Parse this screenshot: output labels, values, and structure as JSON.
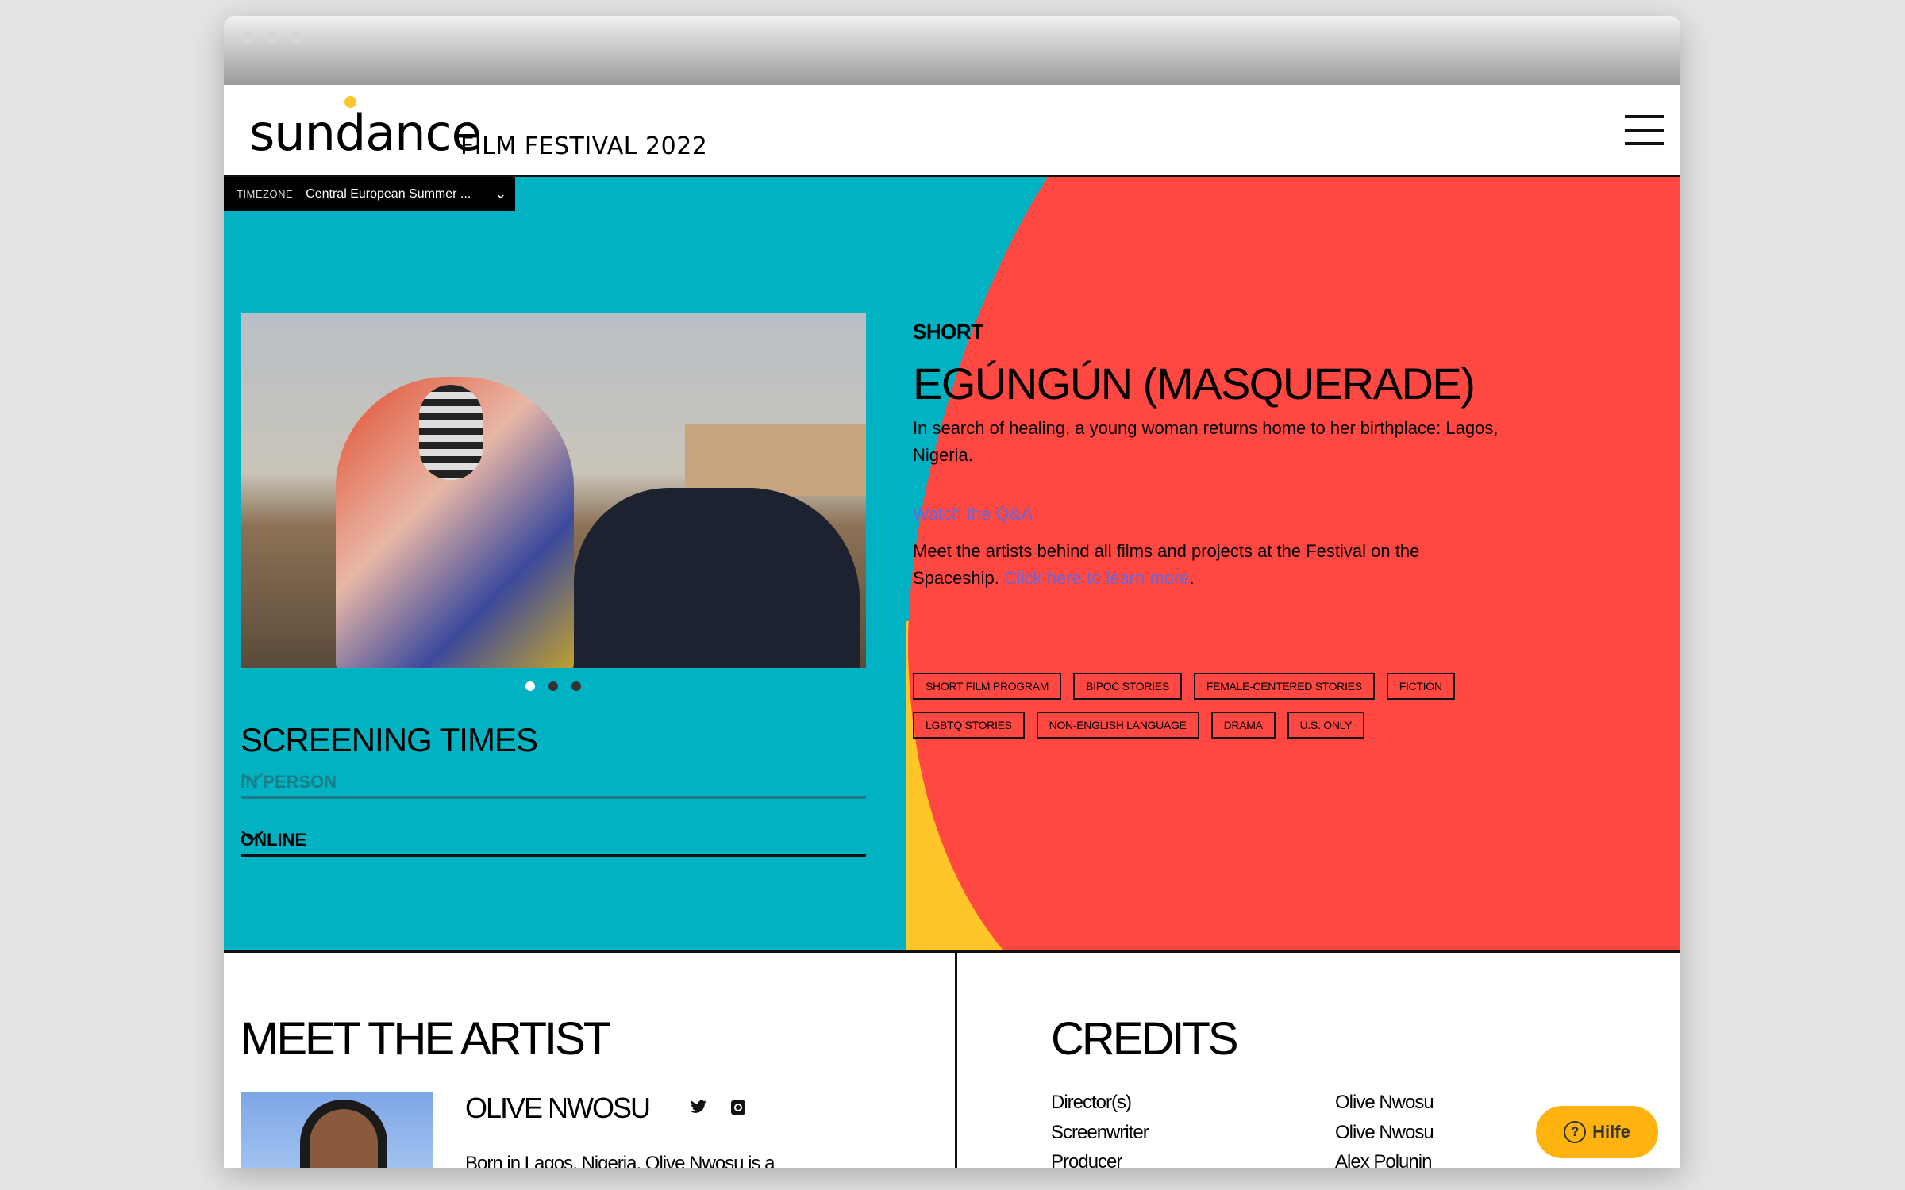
{
  "header": {
    "logo_word": "sundance",
    "logo_sub": "FILM FESTIVAL 2022"
  },
  "timezone": {
    "label": "TIMEZONE",
    "value": "Central European Summer ..."
  },
  "colors": {
    "teal": "#00b2c2",
    "red": "#ff4841",
    "yellow": "#ffc629",
    "link": "#6a66d6",
    "help": "#ffb30f"
  },
  "carousel": {
    "count": 3,
    "active": 1
  },
  "screening": {
    "title": "SCREENING TIMES",
    "items": [
      {
        "label": "IN PERSON"
      },
      {
        "label": "ONLINE"
      }
    ]
  },
  "film": {
    "kind": "SHORT",
    "title": "EGÚNGÚN (MASQUERADE)",
    "description": "In search of healing, a young woman returns home to her birthplace: Lagos, Nigeria.",
    "qa_link": "Watch the Q&A",
    "meet_text": "Meet the artists behind all films and projects at the Festival on the Spaceship.",
    "meet_link": "Click here to learn more",
    "meet_end": ".",
    "tags": [
      "SHORT FILM PROGRAM",
      "BIPOC STORIES",
      "FEMALE-CENTERED STORIES",
      "FICTION",
      "LGBTQ STORIES",
      "NON-ENGLISH LANGUAGE",
      "DRAMA",
      "U.S. ONLY"
    ]
  },
  "artist": {
    "section_title": "MEET THE ARTIST",
    "name": "OLIVE NWOSU",
    "bio": "Born in Lagos, Nigeria, Olive Nwosu is a"
  },
  "credits": {
    "section_title": "CREDITS",
    "rows": [
      {
        "role": "Director(s)",
        "name": "Olive Nwosu"
      },
      {
        "role": "Screenwriter",
        "name": "Olive Nwosu"
      },
      {
        "role": "Producer",
        "name": "Alex Polunin"
      }
    ]
  },
  "help": {
    "label": "Hilfe"
  }
}
